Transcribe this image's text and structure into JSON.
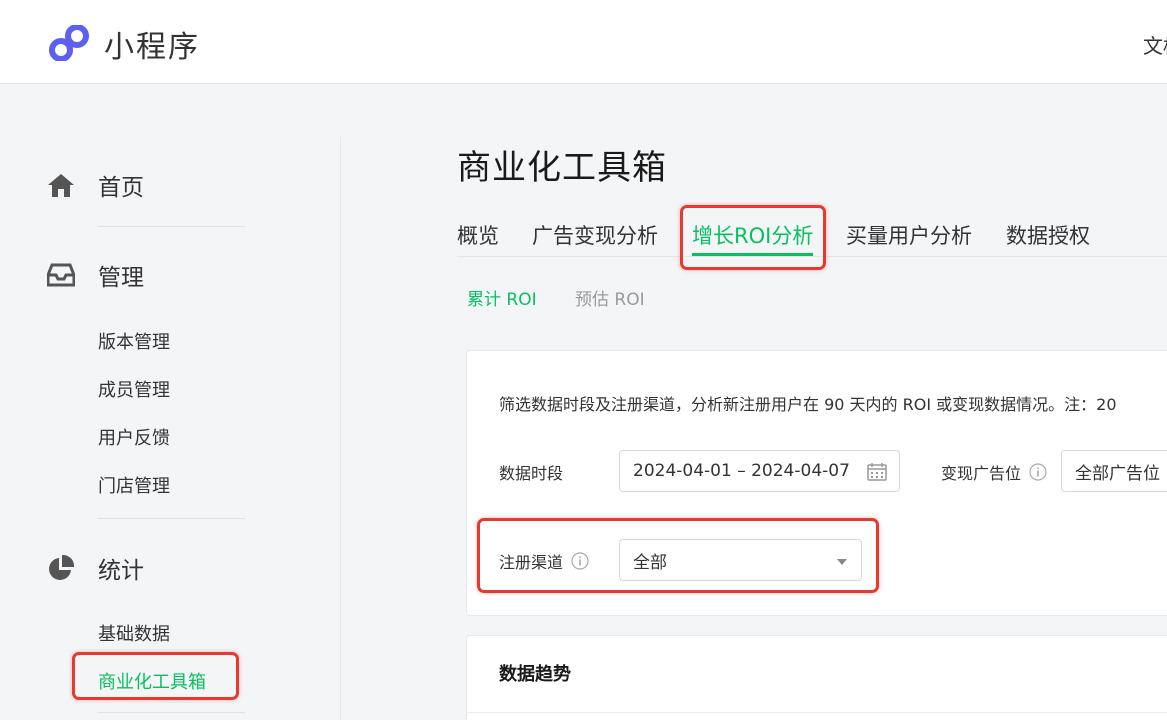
{
  "header": {
    "app_title": "小程序",
    "right_text": "文档",
    "brand_color": "#5d5fef"
  },
  "sidebar": {
    "home": {
      "label": "首页",
      "icon": "home-icon"
    },
    "manage": {
      "label": "管理",
      "icon": "inbox-icon",
      "items": [
        "版本管理",
        "成员管理",
        "用户反馈",
        "门店管理"
      ]
    },
    "stats": {
      "label": "统计",
      "icon": "pie-chart-icon",
      "items": [
        "基础数据",
        "商业化工具箱"
      ],
      "active_item": "商业化工具箱"
    }
  },
  "main": {
    "page_title": "商业化工具箱",
    "tabs": [
      "概览",
      "广告变现分析",
      "增长ROI分析",
      "买量用户分析",
      "数据授权"
    ],
    "active_tab": "增长ROI分析",
    "subtabs": [
      "累计 ROI",
      "预估 ROI"
    ],
    "active_subtab": "累计 ROI",
    "filter_card": {
      "description": "筛选数据时段及注册渠道，分析新注册用户在 90 天内的 ROI 或变现数据情况。注：20",
      "date_label": "数据时段",
      "date_value": "2024-04-01 – 2024-04-07",
      "ad_slot_label": "变现广告位",
      "ad_slot_value": "全部广告位",
      "channel_label": "注册渠道",
      "channel_value": "全部"
    },
    "trend_card": {
      "title": "数据趋势"
    }
  },
  "colors": {
    "accent_green": "#07c160",
    "highlight_red": "#e63a2e"
  }
}
